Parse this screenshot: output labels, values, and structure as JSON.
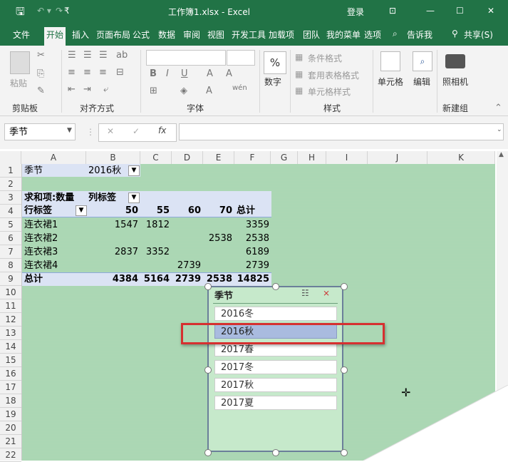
{
  "window": {
    "title": "工作簿1.xlsx  -  Excel",
    "login": "登录",
    "qat_icons": [
      "save-icon",
      "undo-icon",
      "redo-icon",
      "customize-icon"
    ]
  },
  "tabs": [
    "文件",
    "开始",
    "插入",
    "页面布局",
    "公式",
    "数据",
    "审阅",
    "视图",
    "开发工具",
    "加载项",
    "团队",
    "我的菜单",
    "选项"
  ],
  "tell_me": "告诉我",
  "share": "共享(S)",
  "ribbon": {
    "paste": "粘贴",
    "groups": [
      "剪贴板",
      "对齐方式",
      "字体",
      "样式",
      "新建组"
    ],
    "number": "数字",
    "conditional": "条件格式",
    "table_format": "套用表格格式",
    "cell_style": "单元格样式",
    "cells": "单元格",
    "editing": "编辑",
    "camera": "照相机",
    "percent": "%"
  },
  "formula": {
    "name_box": "季节",
    "fx": "fx",
    "content": ""
  },
  "columns": [
    "A",
    "B",
    "C",
    "D",
    "E",
    "F",
    "G",
    "H",
    "I",
    "J",
    "K"
  ],
  "rows": [
    "1",
    "2",
    "3",
    "4",
    "5",
    "6",
    "7",
    "8",
    "9",
    "10",
    "11",
    "12",
    "13",
    "14",
    "15",
    "16",
    "17",
    "18",
    "19",
    "20",
    "21",
    "22"
  ],
  "pivot": {
    "filter_label": "季节",
    "filter_value": "2016秋",
    "sum_label": "求和项:数量",
    "col_label": "列标签",
    "row_label": "行标签",
    "col_values": [
      "50",
      "55",
      "60",
      "70",
      "总计"
    ],
    "rows": [
      {
        "name": "连衣裙1",
        "v50": "1547",
        "v55": "1812",
        "v60": "",
        "v70": "",
        "total": "3359"
      },
      {
        "name": "连衣裙2",
        "v50": "",
        "v55": "",
        "v60": "",
        "v70": "2538",
        "total": "2538"
      },
      {
        "name": "连衣裙3",
        "v50": "2837",
        "v55": "3352",
        "v60": "",
        "v70": "",
        "total": "6189"
      },
      {
        "name": "连衣裙4",
        "v50": "",
        "v55": "",
        "v60": "2739",
        "v70": "",
        "total": "2739"
      }
    ],
    "total_row": {
      "name": "总计",
      "v50": "4384",
      "v55": "5164",
      "v60": "2739",
      "v70": "2538",
      "total": "14825"
    }
  },
  "slicer": {
    "title": "季节",
    "items": [
      "2016冬",
      "2016秋",
      "2017春",
      "2017冬",
      "2017秋",
      "2017夏"
    ],
    "selected": "2016秋"
  },
  "colors": {
    "accent": "#217346",
    "sheet_bg": "#c6e9cb",
    "highlight": "#d63030"
  }
}
